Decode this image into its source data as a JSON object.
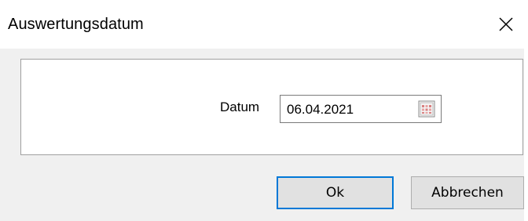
{
  "window": {
    "title": "Auswertungsdatum",
    "close_icon": "close-icon"
  },
  "form": {
    "date_label": "Datum",
    "date_value": "06.04.2021",
    "calendar_icon": "calendar-icon"
  },
  "buttons": {
    "ok_label": "Ok",
    "cancel_label": "Abbrechen"
  },
  "colors": {
    "dialog_background": "#f0f0f0",
    "focus_border": "#0078d7",
    "button_background": "#e1e1e1"
  }
}
